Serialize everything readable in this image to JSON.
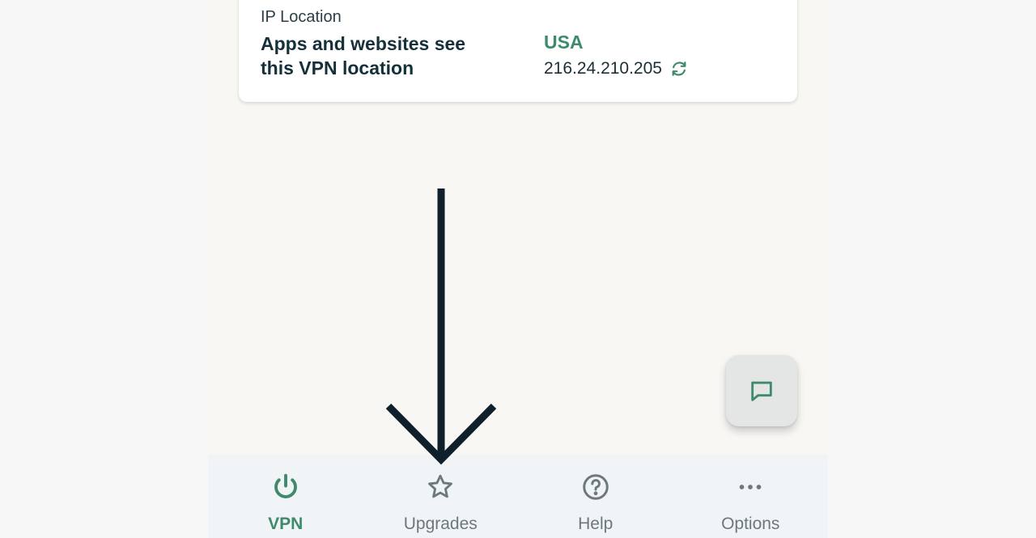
{
  "card": {
    "label": "IP Location",
    "description": "Apps and websites see this VPN location",
    "country": "USA",
    "ip_address": "216.24.210.205"
  },
  "nav": {
    "items": [
      {
        "label": "VPN",
        "icon": "power-icon",
        "active": true
      },
      {
        "label": "Upgrades",
        "icon": "star-icon",
        "active": false
      },
      {
        "label": "Help",
        "icon": "help-circle-icon",
        "active": false
      },
      {
        "label": "Options",
        "icon": "more-horizontal-icon",
        "active": false
      }
    ]
  },
  "colors": {
    "accent": "#3f8a6a",
    "text_dark": "#15303a",
    "nav_inactive": "#6d787d",
    "arrow": "#0f1f2b"
  }
}
